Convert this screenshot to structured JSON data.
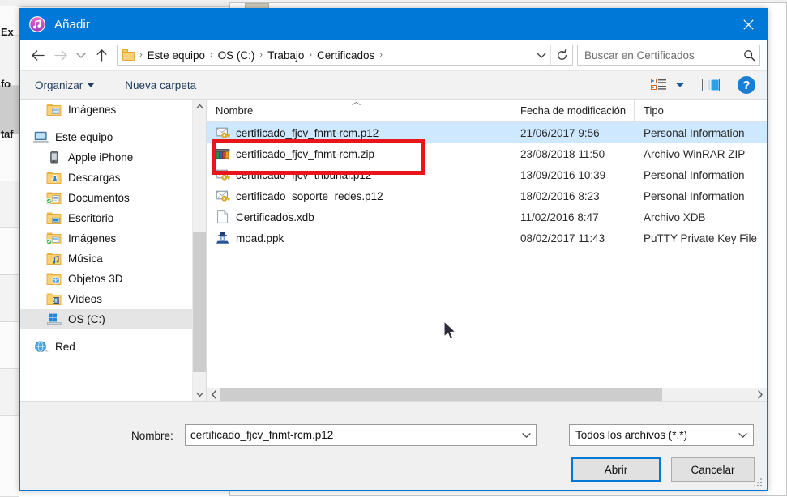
{
  "background": {
    "left_fragments": [
      "Ex",
      "fo",
      "taf"
    ]
  },
  "dialog": {
    "title": "Añadir",
    "app_icon": "itunes-music-note-icon",
    "close_label": "✕"
  },
  "navbar": {
    "back_icon": "arrow-left-icon",
    "forward_icon": "arrow-right-icon",
    "recent_icon": "chevron-down-icon",
    "up_icon": "arrow-up-icon",
    "breadcrumbs": [
      "Este equipo",
      "OS (C:)",
      "Trabajo",
      "Certificados"
    ],
    "separator": "›",
    "address_dropdown_icon": "chevron-down-icon",
    "refresh_icon": "refresh-icon",
    "search_placeholder": "Buscar en Certificados",
    "search_value": "",
    "search_icon": "magnifier-icon"
  },
  "toolbar": {
    "organize_label": "Organizar",
    "new_folder_label": "Nueva carpeta",
    "view_icon": "list-view-icon",
    "view_dropdown_icon": "chevron-down-icon",
    "preview_pane_icon": "preview-pane-icon",
    "help_icon": "help-question-icon"
  },
  "sidebar": {
    "items": [
      {
        "label": "Imágenes",
        "icon": "folder-pictures-icon",
        "indent": 1,
        "selected": false,
        "gap_before": false
      },
      {
        "label": "Este equipo",
        "icon": "this-pc-icon",
        "indent": 0,
        "selected": false,
        "gap_before": true
      },
      {
        "label": "Apple iPhone",
        "icon": "iphone-device-icon",
        "indent": 1,
        "selected": false,
        "gap_before": false
      },
      {
        "label": "Descargas",
        "icon": "folder-downloads-icon",
        "indent": 1,
        "selected": false,
        "gap_before": false
      },
      {
        "label": "Documentos",
        "icon": "folder-documents-sync-icon",
        "indent": 1,
        "selected": false,
        "gap_before": false
      },
      {
        "label": "Escritorio",
        "icon": "folder-desktop-icon",
        "indent": 1,
        "selected": false,
        "gap_before": false
      },
      {
        "label": "Imágenes",
        "icon": "folder-pictures-sync-icon",
        "indent": 1,
        "selected": false,
        "gap_before": false
      },
      {
        "label": "Música",
        "icon": "folder-music-icon",
        "indent": 1,
        "selected": false,
        "gap_before": false
      },
      {
        "label": "Objetos 3D",
        "icon": "folder-3d-objects-icon",
        "indent": 1,
        "selected": false,
        "gap_before": false
      },
      {
        "label": "Vídeos",
        "icon": "folder-videos-icon",
        "indent": 1,
        "selected": false,
        "gap_before": false
      },
      {
        "label": "OS (C:)",
        "icon": "local-disk-icon",
        "indent": 1,
        "selected": true,
        "gap_before": false
      },
      {
        "label": "Red",
        "icon": "network-icon",
        "indent": 0,
        "selected": false,
        "gap_before": true
      }
    ],
    "scroll_up_icon": "chevron-up-icon",
    "scroll_down_icon": "chevron-down-icon"
  },
  "file_list": {
    "columns": [
      "Nombre",
      "Fecha de modificación",
      "Tipo"
    ],
    "sort_indicator": "ascending",
    "rows": [
      {
        "name": "certificado_fjcv_fnmt-rcm.p12",
        "date": "21/06/2017 9:56",
        "type": "Personal Information",
        "icon": "certificate-key-icon",
        "selected": true
      },
      {
        "name": "certificado_fjcv_fnmt-rcm.zip",
        "date": "23/08/2018 11:50",
        "type": "Archivo WinRAR ZIP",
        "icon": "winrar-archive-icon",
        "selected": false
      },
      {
        "name": "certificado_fjcv_tribunal.p12",
        "date": "13/09/2016 10:39",
        "type": "Personal Information",
        "icon": "certificate-key-icon",
        "selected": false
      },
      {
        "name": "certificado_soporte_redes.p12",
        "date": "18/02/2016 8:23",
        "type": "Personal Information",
        "icon": "certificate-key-icon",
        "selected": false
      },
      {
        "name": "Certificados.xdb",
        "date": "11/02/2016 8:47",
        "type": "Archivo XDB",
        "icon": "blank-document-icon",
        "selected": false
      },
      {
        "name": "moad.ppk",
        "date": "08/02/2017 11:43",
        "type": "PuTTY Private Key File",
        "icon": "putty-key-icon",
        "selected": false
      }
    ],
    "h_scroll_left_icon": "chevron-left-icon",
    "h_scroll_right_icon": "chevron-right-icon"
  },
  "footer": {
    "filename_label": "Nombre:",
    "filename_value": "certificado_fjcv_fnmt-rcm.p12",
    "filename_dropdown_icon": "chevron-down-icon",
    "filter_value": "Todos los archivos (*.*)",
    "filter_dropdown_icon": "chevron-down-icon",
    "open_label": "Abrir",
    "cancel_label": "Cancelar"
  },
  "annotation": {
    "color": "#e8161b",
    "target": "certificado_fjcv_fnmt-rcm.p12"
  },
  "colors": {
    "titlebar": "#0078d7",
    "selection": "#cde8ff",
    "toolbar_bg": "#f2f2f2",
    "footer_bg": "#f0f0f0",
    "annotation_red": "#e8161b"
  }
}
